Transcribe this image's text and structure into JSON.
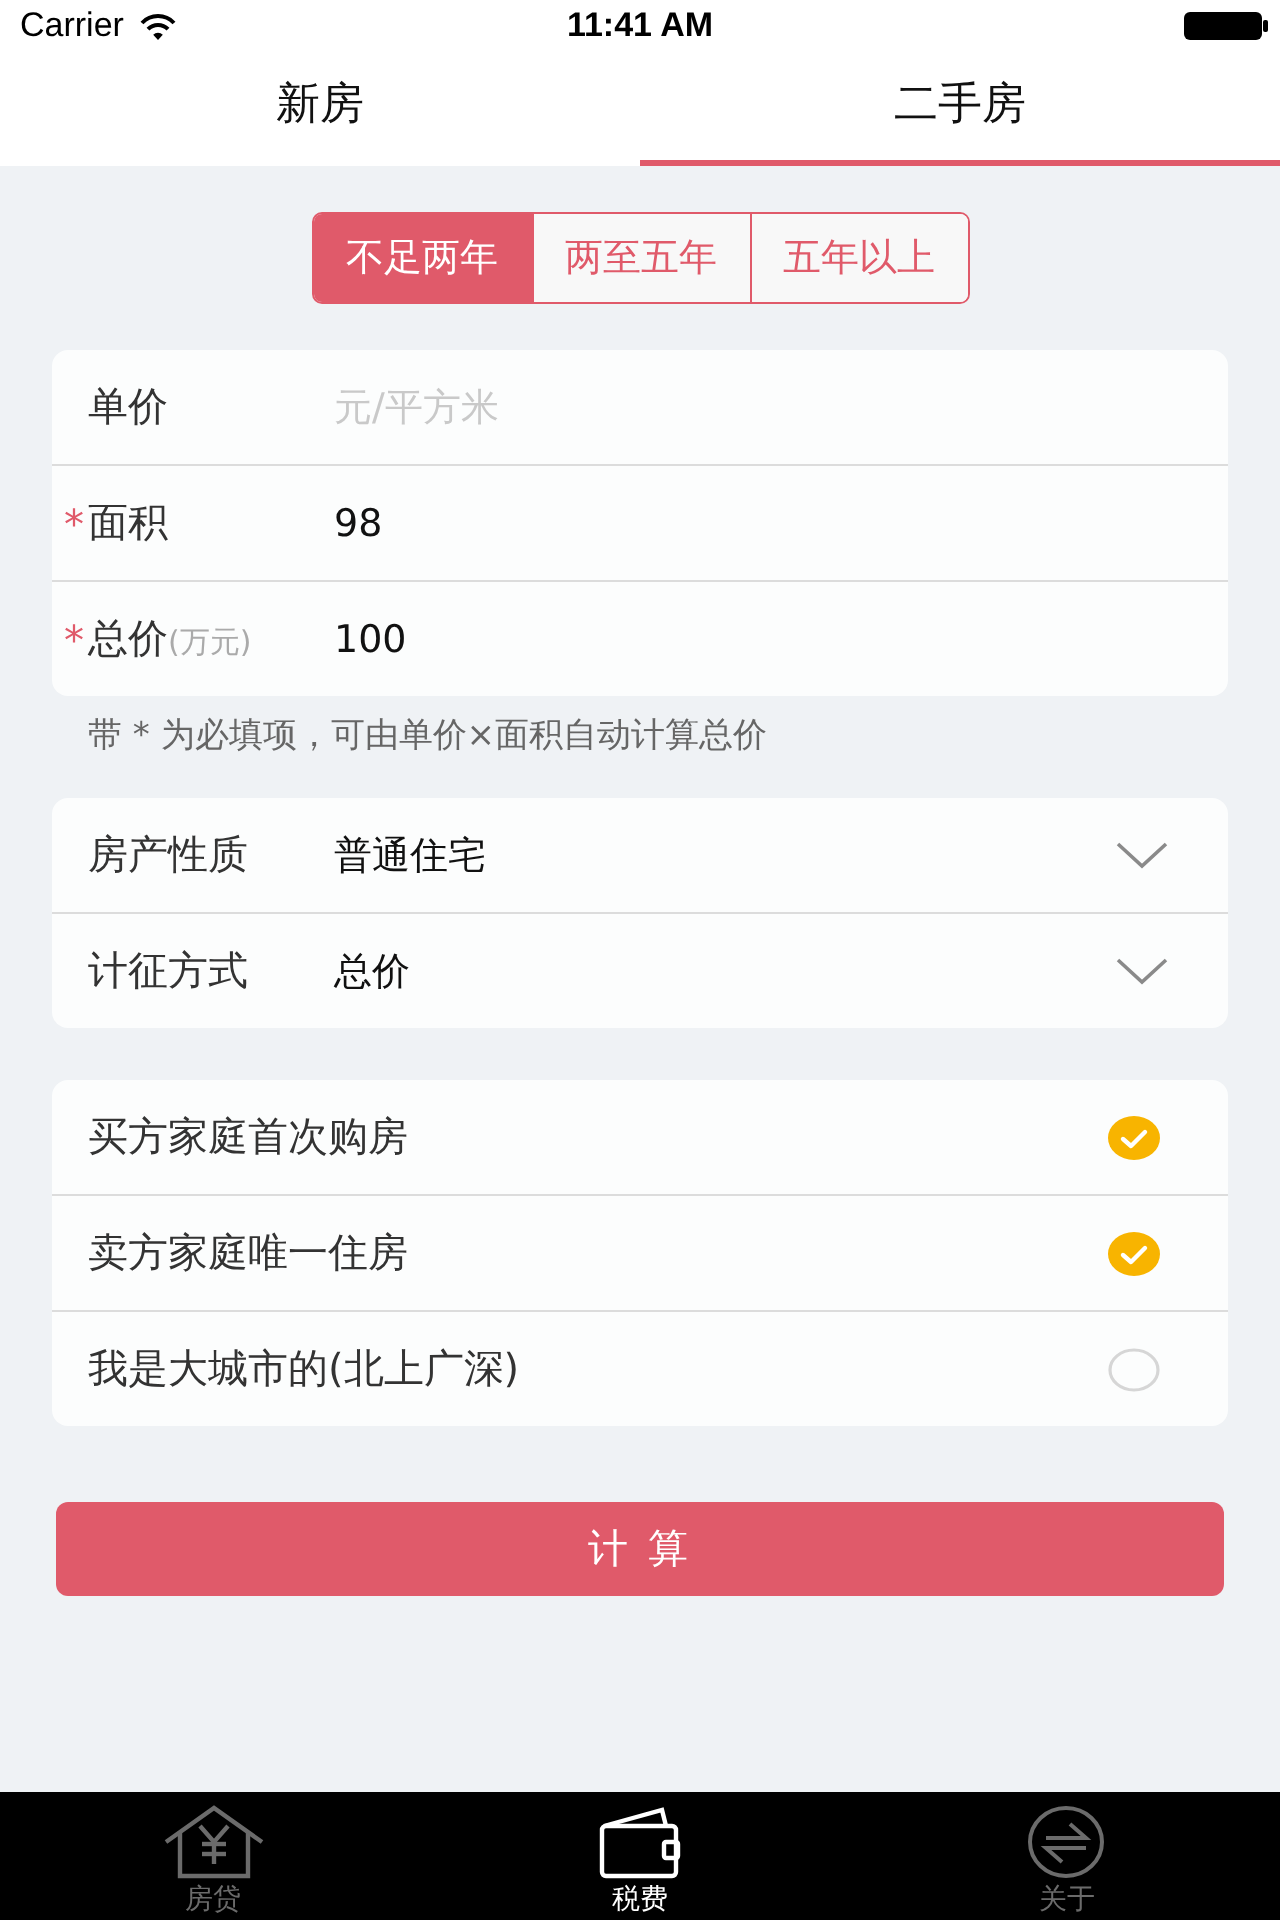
{
  "status_bar": {
    "carrier": "Carrier",
    "time": "11:41 AM"
  },
  "top_tabs": [
    {
      "label": "新房",
      "selected": false
    },
    {
      "label": "二手房",
      "selected": true
    }
  ],
  "period_segments": [
    {
      "label": "不足两年",
      "selected": true
    },
    {
      "label": "两至五年",
      "selected": false
    },
    {
      "label": "五年以上",
      "selected": false
    }
  ],
  "price_fields": [
    {
      "label": "单价",
      "placeholder": "元/平方米"
    },
    {
      "required_mark": "*",
      "label": "面积",
      "value": "98"
    },
    {
      "required_mark": "*",
      "label": "总价",
      "unit": "(万元)",
      "value": "100"
    }
  ],
  "hint": "带 * 为必填项，可由单价×面积自动计算总价",
  "selects": [
    {
      "label": "房产性质",
      "value": "普通住宅"
    },
    {
      "label": "计征方式",
      "value": "总价"
    }
  ],
  "options": [
    {
      "label": "买方家庭首次购房",
      "checked": true
    },
    {
      "label": "卖方家庭唯一住房",
      "checked": true
    },
    {
      "label": "我是大城市的(北上广深)",
      "checked": false
    }
  ],
  "calculate_button": "计 算",
  "tab_bar": [
    {
      "label": "房贷",
      "selected": false
    },
    {
      "label": "税费",
      "selected": true
    },
    {
      "label": "关于",
      "selected": false
    }
  ]
}
